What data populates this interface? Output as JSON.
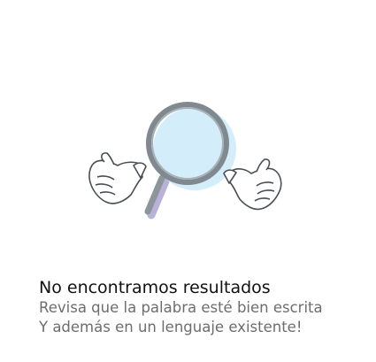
{
  "empty_state": {
    "title": "No encontramos resultados",
    "line1": "Revisa que la palabra esté bien escrita",
    "line2": "Y además en un lenguaje existente!",
    "illustration_icon": "magnifying-glass-shrug-icon",
    "colors": {
      "lens_fill": "#d4edfb",
      "rim": "#8b959b",
      "handle_shadow": "#b7b2d6",
      "glove_outline": "#4a4f53",
      "title_text": "#111111",
      "body_text": "#6d6d6d"
    }
  }
}
